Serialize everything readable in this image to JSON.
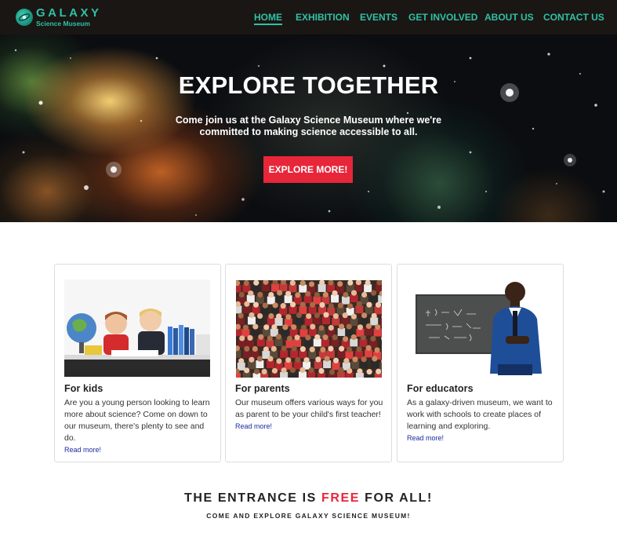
{
  "brand": {
    "title": "GALAXY",
    "subtitle": "Science Museum",
    "accent_color": "#2fc1a7"
  },
  "nav": {
    "items": [
      {
        "label": "HOME",
        "active": true
      },
      {
        "label": "EXHIBITION",
        "active": false
      },
      {
        "label": "EVENTS",
        "active": false
      },
      {
        "label": "GET INVOLVED",
        "active": false
      },
      {
        "label": "ABOUT US",
        "active": false
      },
      {
        "label": "CONTACT US",
        "active": false
      }
    ]
  },
  "hero": {
    "title": "EXPLORE TOGETHER",
    "subtitle": "Come join us at the Galaxy Science Museum where we're committed to making science accessible to all.",
    "button_label": "EXPLORE MORE!",
    "button_color": "#e8263a"
  },
  "cards": [
    {
      "title": "For kids",
      "text": "Are you a young person looking to learn more about science? Come on down to our museum, there's plenty to see and do.",
      "link": "Read more!",
      "image": "kids-studying-photo"
    },
    {
      "title": "For parents",
      "text": "Our museum offers various ways for you as parent to be your child's first teacher!",
      "link": "Read more!",
      "image": "crowd-photo"
    },
    {
      "title": "For educators",
      "text": "As a galaxy-driven museum, we want to work with schools to create places of learning and exploring.",
      "link": "Read more!",
      "image": "teacher-chalkboard-photo"
    }
  ],
  "promo": {
    "title_before": "THE ENTRANCE IS ",
    "title_highlight": "FREE",
    "title_after": " FOR ALL!",
    "subtitle": "COME AND EXPLORE GALAXY SCIENCE MUSEUM!"
  }
}
